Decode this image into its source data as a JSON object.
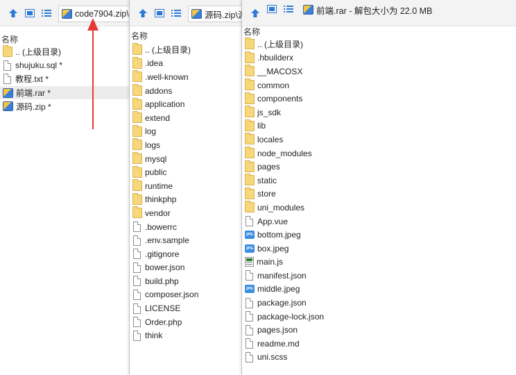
{
  "column_header": "名称",
  "panes": [
    {
      "path": "code7904.zip\\",
      "items": [
        {
          "name": ".. (上级目录)",
          "icon": "folder-icon"
        },
        {
          "name": "shujuku.sql *",
          "icon": "file-icon"
        },
        {
          "name": "教程.txt *",
          "icon": "file-icon"
        },
        {
          "name": "前端.rar *",
          "icon": "archive-icon"
        },
        {
          "name": "源码.zip *",
          "icon": "archive-icon"
        }
      ]
    },
    {
      "path": "源码.zip\\源",
      "items": [
        {
          "name": ".. (上级目录)",
          "icon": "folder-icon"
        },
        {
          "name": ".idea",
          "icon": "folder-icon"
        },
        {
          "name": ".well-known",
          "icon": "folder-icon"
        },
        {
          "name": "addons",
          "icon": "folder-icon"
        },
        {
          "name": "application",
          "icon": "folder-icon"
        },
        {
          "name": "extend",
          "icon": "folder-icon"
        },
        {
          "name": "log",
          "icon": "folder-icon"
        },
        {
          "name": "logs",
          "icon": "folder-icon"
        },
        {
          "name": "mysql",
          "icon": "folder-icon"
        },
        {
          "name": "public",
          "icon": "folder-icon"
        },
        {
          "name": "runtime",
          "icon": "folder-icon"
        },
        {
          "name": "thinkphp",
          "icon": "folder-icon"
        },
        {
          "name": "vendor",
          "icon": "folder-icon"
        },
        {
          "name": ".bowerrc",
          "icon": "file-icon"
        },
        {
          "name": ".env.sample",
          "icon": "file-icon"
        },
        {
          "name": ".gitignore",
          "icon": "file-icon"
        },
        {
          "name": "bower.json",
          "icon": "file-icon"
        },
        {
          "name": "build.php",
          "icon": "file-icon"
        },
        {
          "name": "composer.json",
          "icon": "file-icon"
        },
        {
          "name": "LICENSE",
          "icon": "file-icon"
        },
        {
          "name": "Order.php",
          "icon": "file-icon"
        },
        {
          "name": "think",
          "icon": "file-icon"
        }
      ]
    },
    {
      "path": "前端.rar - 解包大小为 22.0 MB",
      "items": [
        {
          "name": ".. (上级目录)",
          "icon": "folder-icon"
        },
        {
          "name": ".hbuilderx",
          "icon": "folder-icon"
        },
        {
          "name": "__MACOSX",
          "icon": "folder-icon"
        },
        {
          "name": "common",
          "icon": "folder-icon"
        },
        {
          "name": "components",
          "icon": "folder-icon"
        },
        {
          "name": "js_sdk",
          "icon": "folder-icon"
        },
        {
          "name": "lib",
          "icon": "folder-icon"
        },
        {
          "name": "locales",
          "icon": "folder-icon"
        },
        {
          "name": "node_modules",
          "icon": "folder-icon"
        },
        {
          "name": "pages",
          "icon": "folder-icon"
        },
        {
          "name": "static",
          "icon": "folder-icon"
        },
        {
          "name": "store",
          "icon": "folder-icon"
        },
        {
          "name": "uni_modules",
          "icon": "folder-icon"
        },
        {
          "name": "App.vue",
          "icon": "file-icon"
        },
        {
          "name": "bottom.jpeg",
          "icon": "image-icon"
        },
        {
          "name": "box.jpeg",
          "icon": "image-icon"
        },
        {
          "name": "main.js",
          "icon": "js-file-icon"
        },
        {
          "name": "manifest.json",
          "icon": "file-icon"
        },
        {
          "name": "middle.jpeg",
          "icon": "image-icon"
        },
        {
          "name": "package.json",
          "icon": "file-icon"
        },
        {
          "name": "package-lock.json",
          "icon": "file-icon"
        },
        {
          "name": "pages.json",
          "icon": "file-icon"
        },
        {
          "name": "readme.md",
          "icon": "file-icon"
        },
        {
          "name": "uni.scss",
          "icon": "file-icon"
        }
      ]
    }
  ],
  "colors": {
    "toolbar_icon": "#2b79d6",
    "folder": "#f7d77a",
    "annotation_arrow": "#e53935",
    "highlight_row": "#ececec"
  }
}
